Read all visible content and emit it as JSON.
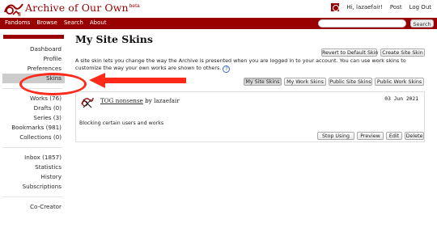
{
  "header": {
    "site_title": "Archive of Our Own",
    "beta_tag": "beta",
    "user_greeting": "Hi, lazaefair!",
    "post_label": "Post",
    "logout_label": "Log Out"
  },
  "primary_nav": {
    "items": [
      "Fandoms",
      "Browse",
      "Search",
      "About"
    ],
    "search_placeholder": "",
    "search_button": "Search"
  },
  "sidebar": {
    "group1": [
      "Dashboard",
      "Profile",
      "Preferences",
      "Skins"
    ],
    "group2": [
      "Works (76)",
      "Drafts (0)",
      "Series (3)",
      "Bookmarks (981)",
      "Collections (0)"
    ],
    "group3": [
      "Inbox (1857)",
      "Statistics",
      "History",
      "Subscriptions"
    ],
    "group4": [
      "Co-Creator"
    ],
    "current_item": "Skins"
  },
  "main": {
    "page_title": "My Site Skins",
    "revert_button": "Revert to Default Skin",
    "create_button": "Create Site Skin",
    "intro_text": "A site skin lets you change the way the Archive is presented when you are logged in to your account. You can use work skins to customize the way your own works are shown to others.",
    "help_icon": "?",
    "tabs": [
      "My Site Skins",
      "My Work Skins",
      "Public Site Skins",
      "Public Work Skins"
    ],
    "active_tab": "My Site Skins",
    "skin": {
      "title": "TOG nonsense",
      "by": "by",
      "author": "lazaefair",
      "date": "03 Jun 2021",
      "description": "Blocking certain users and works",
      "actions": [
        "Stop Using",
        "Preview",
        "Edit",
        "Delete"
      ]
    }
  },
  "annotation": {
    "ellipse_color": "#ff2a1a",
    "arrow_color": "#ff2a1a"
  },
  "colors": {
    "brand": "#990000",
    "nav_text": "#ffffff"
  }
}
